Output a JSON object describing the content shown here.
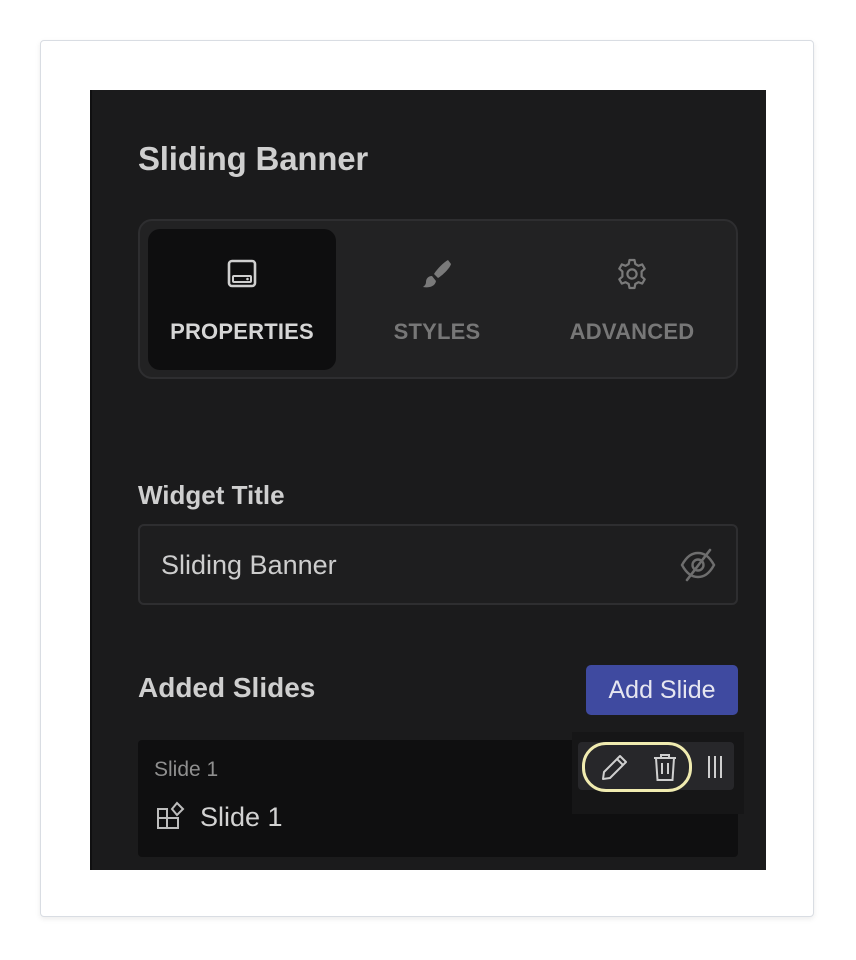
{
  "panel": {
    "title": "Sliding Banner"
  },
  "tabs": [
    {
      "label": "PROPERTIES",
      "icon": "panel-layout-icon",
      "active": true
    },
    {
      "label": "STYLES",
      "icon": "brush-icon",
      "active": false
    },
    {
      "label": "ADVANCED",
      "icon": "gear-icon",
      "active": false
    }
  ],
  "widget_title": {
    "label": "Widget Title",
    "value": "Sliding Banner",
    "visibility_icon": "eye-off-icon"
  },
  "slides": {
    "label": "Added Slides",
    "add_button": "Add Slide",
    "items": [
      {
        "small_label": "Slide 1",
        "name": "Slide 1",
        "icon": "shapes-icon"
      }
    ],
    "actions": [
      "edit-icon",
      "delete-icon",
      "drag-handle-icon"
    ]
  },
  "colors": {
    "panel_bg": "#1b1b1c",
    "accent": "#3f4aa0",
    "highlight": "#f0ebb0"
  }
}
